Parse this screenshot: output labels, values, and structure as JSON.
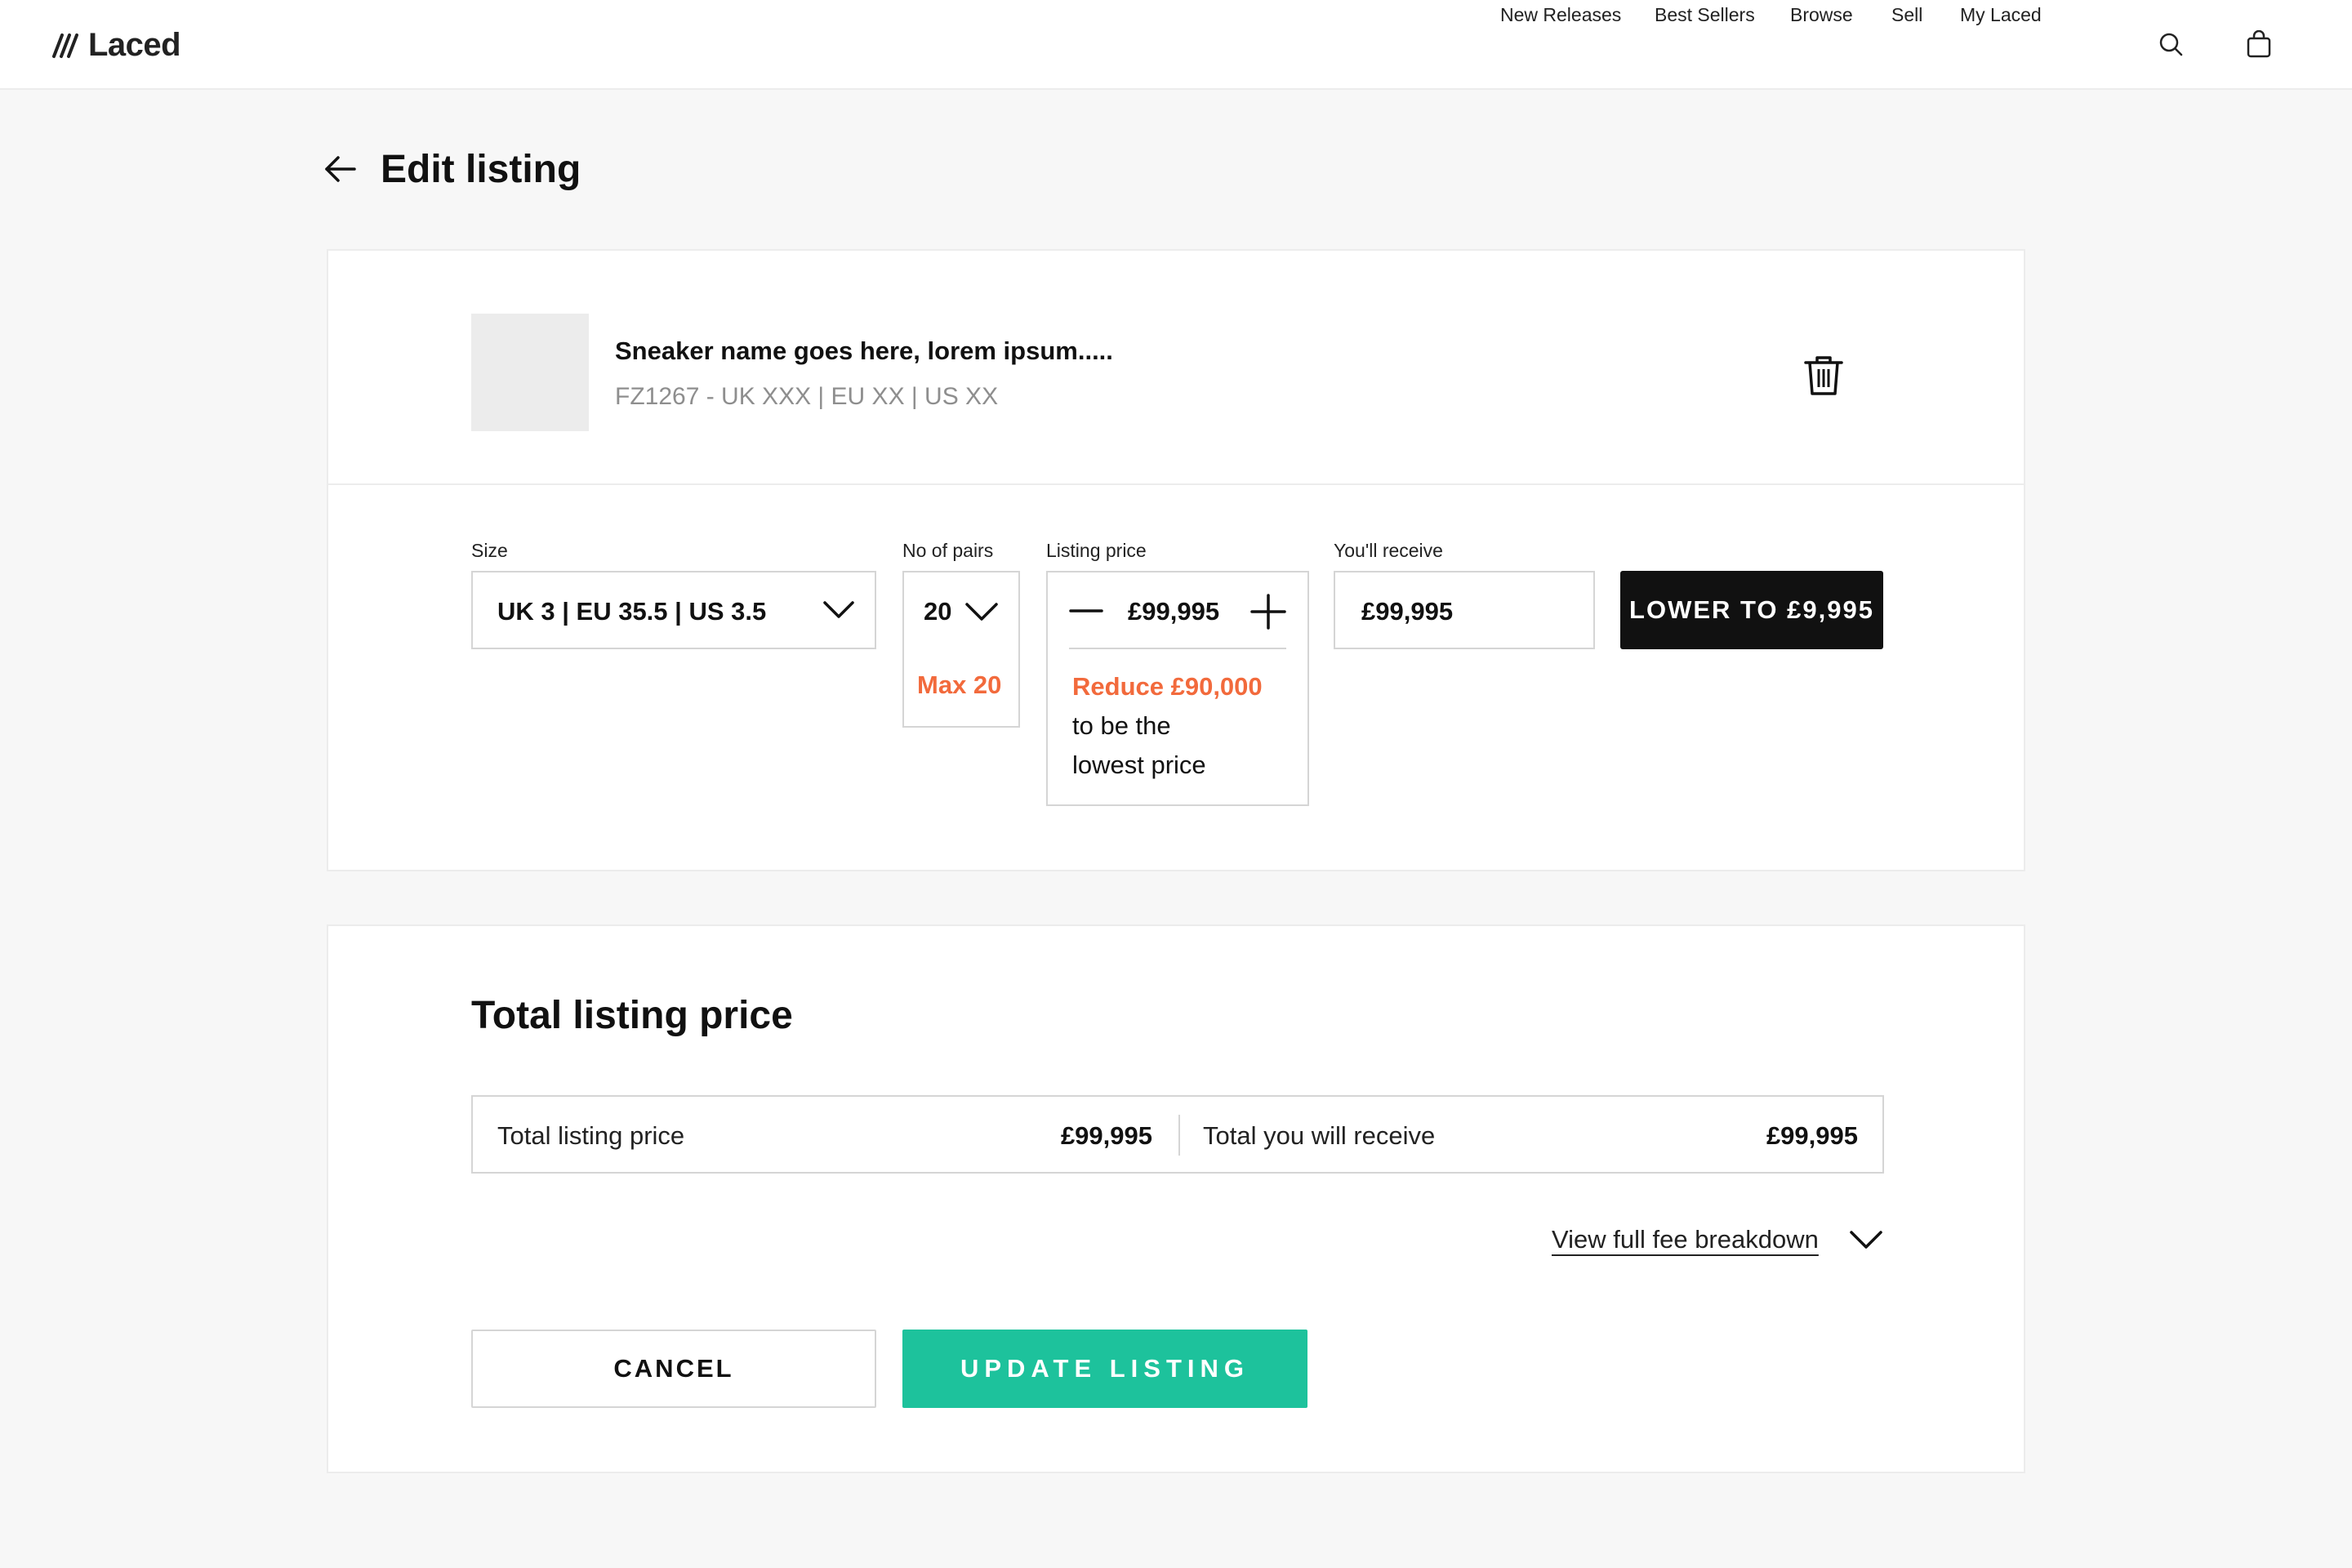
{
  "header": {
    "logo_text": "Laced",
    "nav": [
      "New Releases",
      "Best Sellers",
      "Browse",
      "Sell",
      "My Laced"
    ],
    "icons": [
      "search-icon",
      "bag-icon"
    ]
  },
  "page": {
    "title": "Edit listing",
    "back_icon": "arrow-left-icon"
  },
  "product": {
    "name": "Sneaker name goes here, lorem ipsum.....",
    "meta": "FZ1267 - UK XXX | EU XX | US XX",
    "delete_icon": "trash-icon"
  },
  "listing": {
    "size_label": "Size",
    "size_value": "UK 3 | EU 35.5 | US 3.5",
    "pairs_label": "No of pairs",
    "pairs_value": "20",
    "pairs_max": "Max 20",
    "price_label": "Listing price",
    "price_value": "£99,995",
    "price_hint_highlight": "Reduce £90,000",
    "price_hint_line1": "to be the",
    "price_hint_line2": "lowest price",
    "receive_label": "You'll receive",
    "receive_value": "£99,995",
    "lower_button": "LOWER TO £9,995"
  },
  "summary": {
    "title": "Total listing price",
    "total_label": "Total listing price",
    "total_value": "£99,995",
    "receive_label": "Total you will receive",
    "receive_value": "£99,995",
    "fee_link": "View full fee breakdown",
    "cancel_button": "CANCEL",
    "update_button": "UPDATE LISTING"
  },
  "colors": {
    "accent_green": "#1dc29c",
    "warning_orange": "#f26a3c",
    "dark_button": "#111111"
  }
}
